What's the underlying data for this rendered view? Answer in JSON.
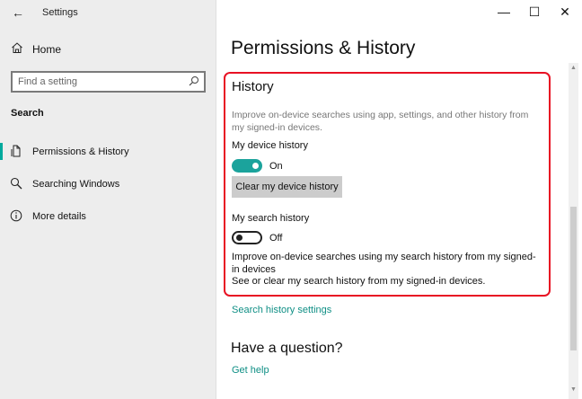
{
  "window": {
    "app_title": "Settings",
    "back_glyph": "←",
    "minimize_glyph": "—",
    "maximize_glyph": "☐",
    "close_glyph": "✕"
  },
  "sidebar": {
    "home_label": "Home",
    "home_icon": "home-icon",
    "search_placeholder": "Find a setting",
    "search_icon": "search-icon",
    "section_label": "Search",
    "items": [
      {
        "label": "Permissions & History",
        "icon": "permissions-icon",
        "active": true
      },
      {
        "label": "Searching Windows",
        "icon": "search-icon",
        "active": false
      },
      {
        "label": "More details",
        "icon": "info-icon",
        "active": false
      }
    ]
  },
  "main": {
    "page_title": "Permissions & History",
    "history": {
      "heading": "History",
      "description": "Improve on-device searches using app, settings, and other history from my signed-in devices.",
      "device_history_label": "My device history",
      "device_history_state": "On",
      "clear_button_label": "Clear my device history",
      "search_history_label": "My search history",
      "search_history_state": "Off",
      "search_history_desc": "Improve on-device searches using my search history from my signed-in devices",
      "search_history_see": "See or clear my search history from my signed-in devices."
    },
    "search_history_settings_link": "Search history settings",
    "question_heading": "Have a question?",
    "get_help_link": "Get help"
  },
  "colors": {
    "accent": "#1ba39c",
    "link": "#0f8f85",
    "highlight_border": "#e81123",
    "sidebar_bg": "#ededed"
  }
}
